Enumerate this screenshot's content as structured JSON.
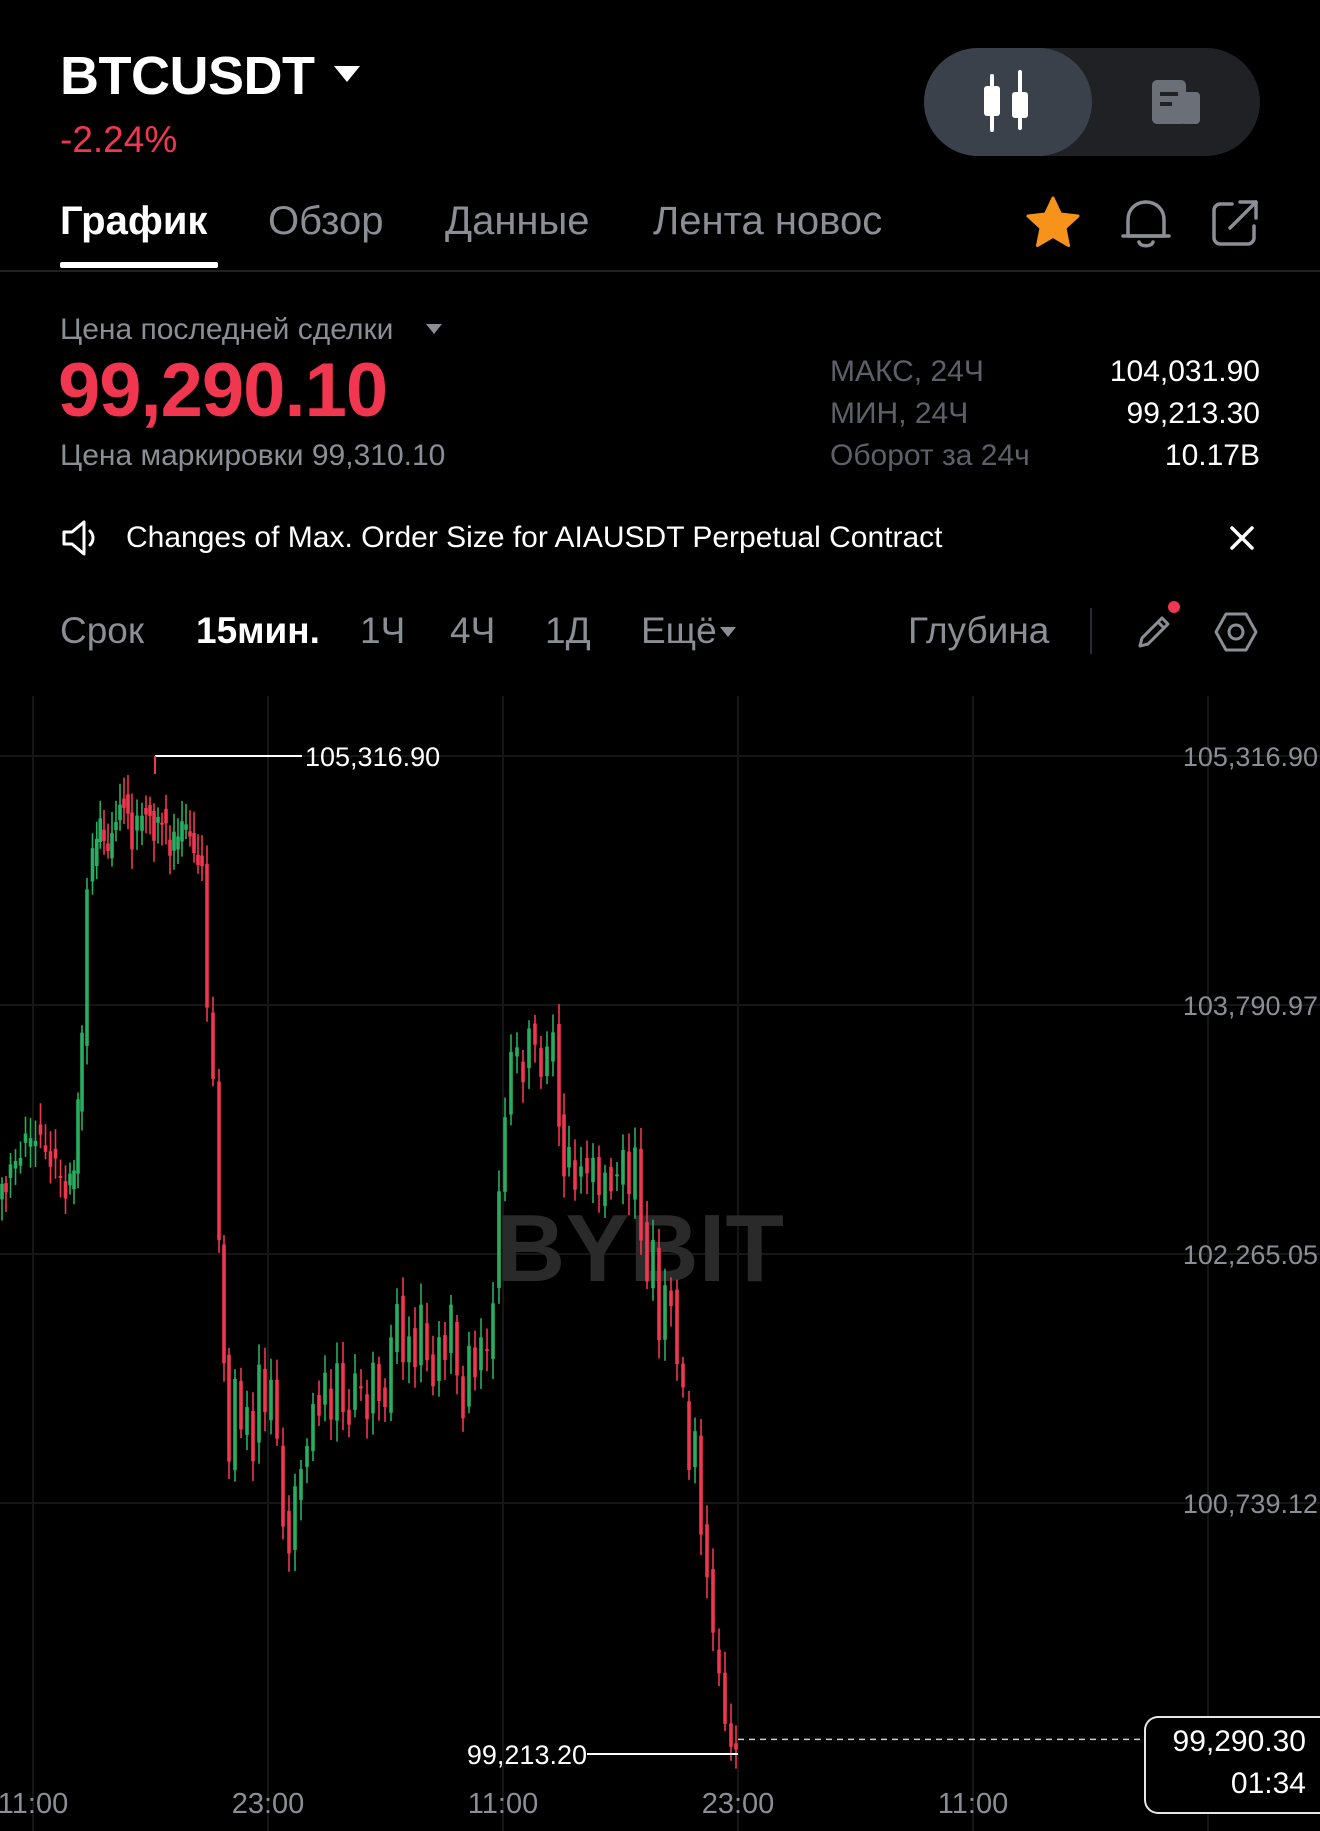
{
  "header": {
    "symbol": "BTCUSDT",
    "change": "-2.24%",
    "view_toggle": {
      "chart_icon": "candlestick-icon",
      "info_icon": "document-icon",
      "active": "chart"
    }
  },
  "tabs": [
    {
      "label": "График",
      "active": true
    },
    {
      "label": "Обзор",
      "active": false
    },
    {
      "label": "Данные",
      "active": false
    },
    {
      "label": "Лента новос",
      "active": false
    }
  ],
  "actions": {
    "star_color": "#f7931a",
    "icons": [
      "star-icon",
      "bell-icon",
      "share-icon"
    ]
  },
  "price": {
    "last_label": "Цена последней сделки",
    "last": "99,290.10",
    "mark": "Цена маркировки 99,310.10",
    "last_color": "#f0374f"
  },
  "stats": {
    "high_label": "МАКС, 24Ч",
    "high": "104,031.90",
    "low_label": "МИН, 24Ч",
    "low": "99,213.30",
    "turnover_label": "Оборот за 24ч",
    "turnover": "10.17B"
  },
  "announcement": {
    "text": "Changes of Max. Order Size for AIAUSDT Perpetual Contract"
  },
  "interval_bar": {
    "label": "Срок",
    "options": [
      "15мин.",
      "1Ч",
      "4Ч",
      "1Д"
    ],
    "selected": "15мин.",
    "more": "Ещё",
    "depth": "Глубина"
  },
  "chart_data": {
    "type": "candlestick",
    "watermark": "BYBIT",
    "y_ticks": [
      "105,316.90",
      "103,790.97",
      "102,265.05",
      "100,739.12"
    ],
    "x_ticks": [
      "11:00",
      "23:00",
      "11:00",
      "23:00",
      "11:00",
      "23:00"
    ],
    "ylim": [
      99100,
      105600
    ],
    "high_marker": "105,316.90",
    "low_marker": "99,213.20",
    "current_price": "99,290.30",
    "countdown": "01:34",
    "up_color": "#27ae60",
    "down_color": "#f0374f",
    "path_points": [
      [
        0,
        102600
      ],
      [
        8,
        102680
      ],
      [
        18,
        102850
      ],
      [
        28,
        102950
      ],
      [
        38,
        103000
      ],
      [
        48,
        102900
      ],
      [
        58,
        102800
      ],
      [
        68,
        102650
      ],
      [
        76,
        102780
      ],
      [
        84,
        103600
      ],
      [
        90,
        104500
      ],
      [
        95,
        104700
      ],
      [
        102,
        104900
      ],
      [
        110,
        104750
      ],
      [
        118,
        104950
      ],
      [
        126,
        105050
      ],
      [
        134,
        104800
      ],
      [
        140,
        104900
      ],
      [
        148,
        105000
      ],
      [
        156,
        104850
      ],
      [
        164,
        104950
      ],
      [
        172,
        104750
      ],
      [
        180,
        104850
      ],
      [
        188,
        104900
      ],
      [
        196,
        104700
      ],
      [
        204,
        104600
      ],
      [
        210,
        103800
      ],
      [
        216,
        103300
      ],
      [
        222,
        102300
      ],
      [
        226,
        101600
      ],
      [
        232,
        101000
      ],
      [
        238,
        101450
      ],
      [
        244,
        101150
      ],
      [
        250,
        101350
      ],
      [
        256,
        101050
      ],
      [
        262,
        101600
      ],
      [
        268,
        101250
      ],
      [
        274,
        101450
      ],
      [
        280,
        101150
      ],
      [
        286,
        100650
      ],
      [
        292,
        100450
      ],
      [
        298,
        100800
      ],
      [
        304,
        100900
      ],
      [
        310,
        101100
      ],
      [
        316,
        101400
      ],
      [
        322,
        101300
      ],
      [
        328,
        101500
      ],
      [
        334,
        101200
      ],
      [
        340,
        101600
      ],
      [
        346,
        101350
      ],
      [
        352,
        101250
      ],
      [
        358,
        101500
      ],
      [
        364,
        101400
      ],
      [
        370,
        101250
      ],
      [
        376,
        101650
      ],
      [
        382,
        101400
      ],
      [
        388,
        101300
      ],
      [
        394,
        101700
      ],
      [
        400,
        101950
      ],
      [
        406,
        101650
      ],
      [
        412,
        101800
      ],
      [
        418,
        101550
      ],
      [
        424,
        101900
      ],
      [
        430,
        101600
      ],
      [
        436,
        101500
      ],
      [
        442,
        101800
      ],
      [
        448,
        101600
      ],
      [
        454,
        101900
      ],
      [
        460,
        101500
      ],
      [
        466,
        101300
      ],
      [
        472,
        101750
      ],
      [
        478,
        101500
      ],
      [
        484,
        101700
      ],
      [
        490,
        101650
      ],
      [
        496,
        102000
      ],
      [
        502,
        102700
      ],
      [
        508,
        103100
      ],
      [
        514,
        103450
      ],
      [
        520,
        103500
      ],
      [
        526,
        103350
      ],
      [
        532,
        103700
      ],
      [
        538,
        103550
      ],
      [
        544,
        103300
      ],
      [
        550,
        103500
      ],
      [
        556,
        103650
      ],
      [
        562,
        103100
      ],
      [
        566,
        102750
      ],
      [
        572,
        102900
      ],
      [
        578,
        102700
      ],
      [
        584,
        102850
      ],
      [
        590,
        102750
      ],
      [
        596,
        102800
      ],
      [
        602,
        102600
      ],
      [
        608,
        102800
      ],
      [
        614,
        102700
      ],
      [
        620,
        102750
      ],
      [
        626,
        102850
      ],
      [
        632,
        102600
      ],
      [
        638,
        102950
      ],
      [
        644,
        102400
      ],
      [
        650,
        102100
      ],
      [
        656,
        102300
      ],
      [
        662,
        101700
      ],
      [
        668,
        102100
      ],
      [
        674,
        102000
      ],
      [
        680,
        101600
      ],
      [
        686,
        101400
      ],
      [
        692,
        100900
      ],
      [
        698,
        101200
      ],
      [
        704,
        100600
      ],
      [
        710,
        100300
      ],
      [
        716,
        99900
      ],
      [
        722,
        99650
      ],
      [
        728,
        99400
      ],
      [
        734,
        99300
      ],
      [
        738,
        99250
      ]
    ]
  }
}
